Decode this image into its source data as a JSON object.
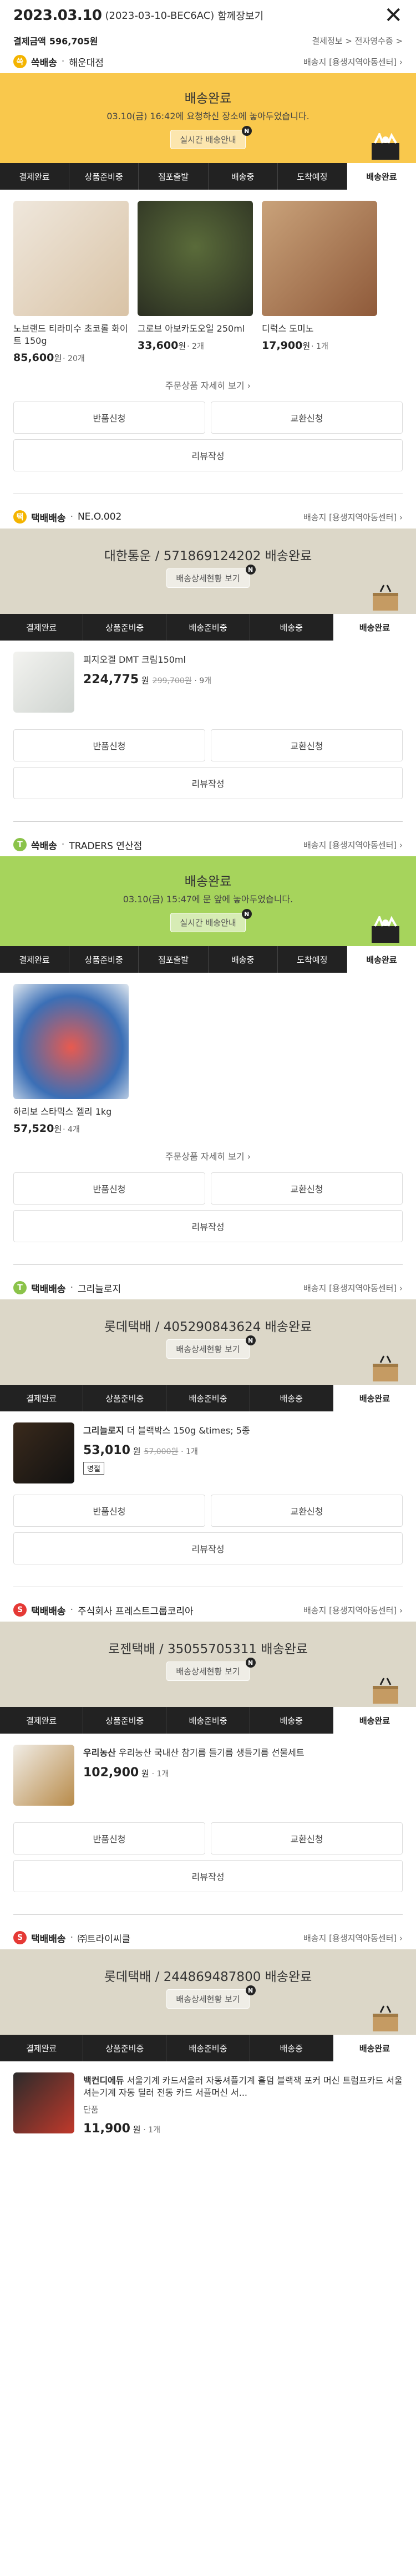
{
  "header": {
    "date": "2023.03.10",
    "order_no": "(2023-03-10-BEC6AC)",
    "title_suffix": "함께장보기",
    "close_icon": "✕"
  },
  "payment": {
    "label": "결제금액",
    "amount": "596,705원",
    "links": "결제정보 > 전자영수증 >"
  },
  "common": {
    "return_btn": "반품신청",
    "exchange_btn": "교환신청",
    "review_btn": "리뷰작성",
    "more_text": "주문상품 자세히 보기 ›",
    "arrow_badge": "N",
    "steps7": [
      "결제완료",
      "상품준비중",
      "점포출발",
      "배송중",
      "도착예정",
      "배송완료"
    ],
    "steps6": [
      "결제완료",
      "상품준비중",
      "배송준비중",
      "배송중",
      "배송완료"
    ],
    "delivery_info": "배송지 [용생지역아동센터] ›"
  },
  "sections": [
    {
      "badge": "쓱",
      "badge_color": "#f4b400",
      "type": "쓱배송",
      "seller": "해운대점",
      "banner_color": "#f9c84c",
      "banner_title": "배송완료",
      "banner_sub": "03.10(금) 16:42에 요청하신 장소에 놓아두었습니다.",
      "banner_btn": "실시간 배송안내",
      "products": [
        {
          "name": "노브랜드 티라미수 초코롤 화이트 150g",
          "price": "85,600",
          "unit": "원",
          "qty": "· 20개"
        },
        {
          "name": "그로브 아보카도오일 250ml",
          "price": "33,600",
          "unit": "원",
          "qty": "· 2개"
        },
        {
          "name": "디럭스 도미노",
          "price": "17,900",
          "unit": "원",
          "qty": "· 1개"
        }
      ]
    },
    {
      "badge": "택",
      "badge_color": "#f4b400",
      "type": "택배배송",
      "seller": "NE.O.002",
      "banner_color": "#dcd7c8",
      "banner_title": "대한통운 / 571869124202 배송완료",
      "banner_btn": "배송상세현황 보기",
      "product": {
        "name": "피지오겔 DMT 크림150ml",
        "price": "224,775",
        "unit": "원",
        "orig": "299,700원",
        "qty": "· 9개"
      }
    },
    {
      "badge": "T",
      "badge_color": "#8bc34a",
      "type": "쓱배송",
      "seller": "TRADERS 연산점",
      "banner_color": "#a6d45c",
      "banner_title": "배송완료",
      "banner_sub": "03.10(금) 15:47에 문 앞에 놓아두었습니다.",
      "banner_btn": "실시간 배송안내",
      "products": [
        {
          "name": "하리보 스타믹스 젤리 1kg",
          "price": "57,520",
          "unit": "원",
          "qty": "· 4개"
        }
      ]
    },
    {
      "badge": "T",
      "badge_color": "#8bc34a",
      "type": "택배배송",
      "seller": "그리늘로지",
      "banner_color": "#dcd7c8",
      "banner_title": "롯데택배 / 405290843624 배송완료",
      "banner_btn": "배송상세현황 보기",
      "product": {
        "name_bold": "그리늘로지",
        "name": "더 블랙박스 150g &times; 5종",
        "price": "53,010",
        "unit": "원",
        "orig": "57,000원",
        "qty": "· 1개",
        "tag": "명절"
      }
    },
    {
      "badge": "S",
      "badge_color": "#e53935",
      "type": "택배배송",
      "seller": "주식회사 프레스트그룹코리아",
      "banner_color": "#dcd7c8",
      "banner_title": "로젠택배 / 35055705311 배송완료",
      "banner_btn": "배송상세현황 보기",
      "product": {
        "name_bold": "우리농산",
        "name": "우리농산 국내산 참기름 들기름 생들기름 선물세트",
        "price": "102,900",
        "unit": "원",
        "qty": "· 1개"
      }
    },
    {
      "badge": "S",
      "badge_color": "#e53935",
      "type": "택배배송",
      "seller": "㈜트라이씨클",
      "banner_color": "#dcd7c8",
      "banner_title": "롯데택배 / 244869487800 배송완료",
      "banner_btn": "배송상세현황 보기",
      "product": {
        "name_bold": "백컨디에듀",
        "name": "서울기계 카드서울러 자동셔플기계 홀덤 블랙잭 포커 머신 트럼프카드 서울셔는기계 자동 딜러 전동 카드 서플머신 서...",
        "option": "단품",
        "price": "11,900",
        "unit": "원",
        "qty": "· 1개"
      }
    }
  ],
  "colors": {
    "dark": "#222222",
    "yellow": "#f9c84c",
    "green": "#a6d45c",
    "beige": "#dcd7c8"
  }
}
